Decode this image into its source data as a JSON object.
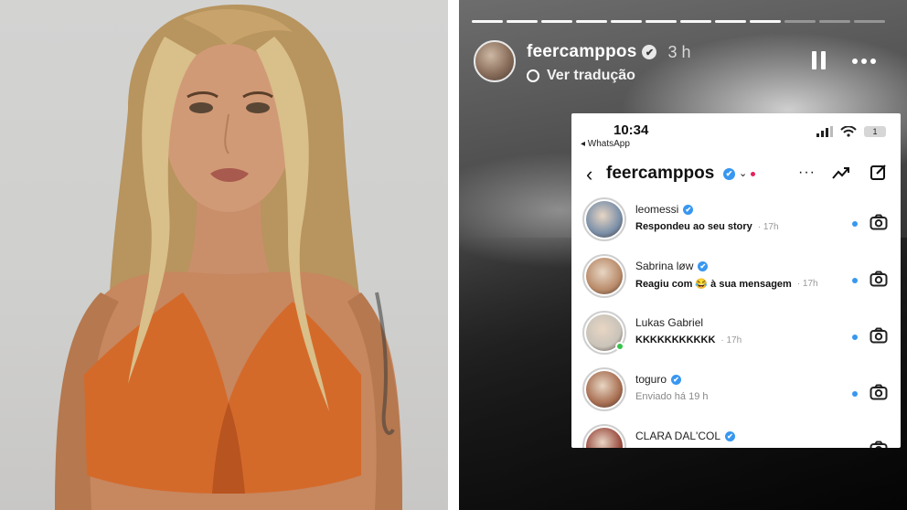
{
  "story": {
    "username": "feercamppos",
    "time": "3 h",
    "translate_label": "Ver tradução",
    "verified_glyph": "✔",
    "progress": {
      "segments": 12,
      "completed": 9
    },
    "icons": {
      "avatar": "profile-avatar",
      "translate": "translate-icon",
      "pause": "pause-icon",
      "more": "more-icon"
    }
  },
  "dm_screenshot": {
    "status_bar": {
      "time": "10:34",
      "back_app": "◂ WhatsApp",
      "battery": "1"
    },
    "header": {
      "back_glyph": "‹",
      "account": "feercamppos",
      "verified_glyph": "✔",
      "caret": "⌄",
      "more": "···"
    },
    "conversations": [
      {
        "name": "leomessi",
        "verified": true,
        "message": "Respondeu ao seu story",
        "time": "17h",
        "unread": true,
        "online": false,
        "avatar_color": "#7a8fa8"
      },
      {
        "name": "Sabrina løw",
        "verified": true,
        "message": "Reagiu com 😂 à sua mensagem",
        "time": "17h",
        "unread": true,
        "online": false,
        "avatar_color": "#b98b6a"
      },
      {
        "name": "Lukas Gabriel",
        "verified": false,
        "message": "KKKKKKKKKKK",
        "time": "17h",
        "unread": true,
        "online": true,
        "avatar_color": "#c9c3b9"
      },
      {
        "name": "toguro",
        "verified": true,
        "message": "Enviado há 19 h",
        "time": "",
        "unread": true,
        "online": false,
        "avatar_color": "#a86f52"
      },
      {
        "name": "CLARA DAL'COL",
        "verified": true,
        "message": "",
        "time": "",
        "unread": false,
        "online": false,
        "avatar_color": "#9c4f43"
      }
    ]
  },
  "colors": {
    "ig_blue": "#3897f0",
    "top_color": "#d46a2a",
    "online_green": "#38c24a"
  }
}
